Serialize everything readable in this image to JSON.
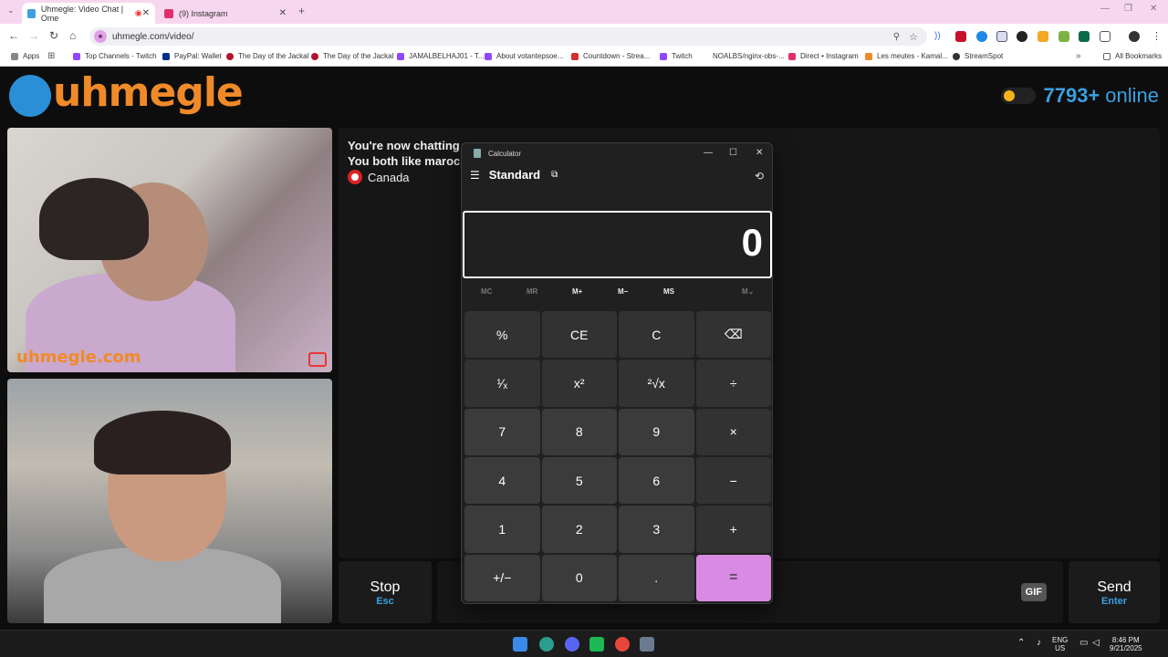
{
  "browser": {
    "tabs": [
      {
        "title": "Uhmegle: Video Chat | Ome",
        "active": true,
        "favicon_color": "#3aa0e0"
      },
      {
        "title": "(9) Instagram",
        "active": false,
        "favicon_color": "#e1306c"
      }
    ],
    "new_tab": "+",
    "url": "uhmegle.com/video/",
    "bookmarks": [
      {
        "label": "Apps",
        "color": "#888"
      },
      {
        "label": "Top Channels - Twitch",
        "color": "#9146ff"
      },
      {
        "label": "PayPal: Wallet",
        "color": "#003087"
      },
      {
        "label": "The Day of the Jackal",
        "color": "#b3122d"
      },
      {
        "label": "The Day of the Jackal",
        "color": "#b3122d"
      },
      {
        "label": "JAMALBELHAJ01 - T...",
        "color": "#9146ff"
      },
      {
        "label": "About votantepsoe...",
        "color": "#9146ff"
      },
      {
        "label": "Countdown - Strea...",
        "color": "#d32f2f"
      },
      {
        "label": "Twitch",
        "color": "#9146ff"
      },
      {
        "label": "NOALBS/nginx-obs-...",
        "color": "#333"
      },
      {
        "label": "Direct • Instagram",
        "color": "#e1306c"
      },
      {
        "label": "Les meutes - Kamal...",
        "color": "#f08a28"
      },
      {
        "label": "StreamSpot",
        "color": "#333"
      }
    ],
    "all_bookmarks": "All Bookmarks",
    "more_bookmarks": "»"
  },
  "site": {
    "logo_text": "uhmegle",
    "online_count": "7793+",
    "online_label": "online",
    "watermark": "uhmegle.com",
    "chat_line1": "You're now chatting w",
    "chat_line2": "You both like maroc",
    "country": "Canada",
    "stop_label": "Stop",
    "stop_key": "Esc",
    "gif_label": "GIF",
    "send_label": "Send",
    "send_key": "Enter",
    "brand_color": "#f08a28",
    "accent_color": "#3aa0e0"
  },
  "calculator": {
    "window_title": "Calculator",
    "mode": "Standard",
    "display": "0",
    "memory": [
      "MC",
      "MR",
      "M+",
      "M−",
      "MS",
      "M⌄"
    ],
    "keys": [
      {
        "label": "%",
        "kind": "op"
      },
      {
        "label": "CE",
        "kind": "op"
      },
      {
        "label": "C",
        "kind": "op"
      },
      {
        "label": "⌫",
        "kind": "op"
      },
      {
        "label": "¹⁄ₓ",
        "kind": "op"
      },
      {
        "label": "x²",
        "kind": "op"
      },
      {
        "label": "²√x",
        "kind": "op"
      },
      {
        "label": "÷",
        "kind": "op"
      },
      {
        "label": "7",
        "kind": "num"
      },
      {
        "label": "8",
        "kind": "num"
      },
      {
        "label": "9",
        "kind": "num"
      },
      {
        "label": "×",
        "kind": "op"
      },
      {
        "label": "4",
        "kind": "num"
      },
      {
        "label": "5",
        "kind": "num"
      },
      {
        "label": "6",
        "kind": "num"
      },
      {
        "label": "−",
        "kind": "op"
      },
      {
        "label": "1",
        "kind": "num"
      },
      {
        "label": "2",
        "kind": "num"
      },
      {
        "label": "3",
        "kind": "num"
      },
      {
        "label": "+",
        "kind": "op"
      },
      {
        "label": "+/−",
        "kind": "num"
      },
      {
        "label": "0",
        "kind": "num"
      },
      {
        "label": ".",
        "kind": "num"
      },
      {
        "label": "=",
        "kind": "eq"
      }
    ],
    "equals_color": "#d98ae2"
  },
  "taskbar": {
    "lang_line1": "ENG",
    "lang_line2": "US",
    "time": "8:46 PM",
    "date": "9/21/2025"
  }
}
